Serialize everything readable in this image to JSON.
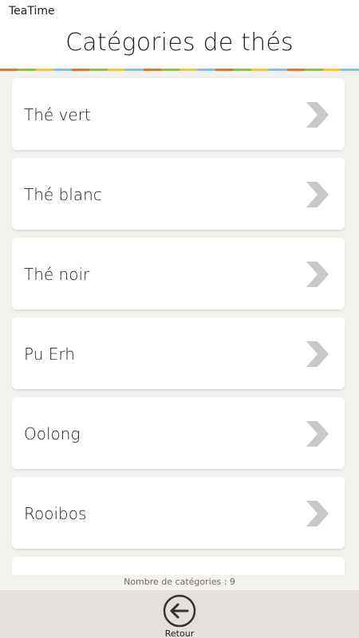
{
  "header": {
    "app_title": "TeaTime",
    "page_title": "Catégories de thés"
  },
  "categories": [
    {
      "label": "Thé vert"
    },
    {
      "label": "Thé blanc"
    },
    {
      "label": "Thé noir"
    },
    {
      "label": "Pu Erh"
    },
    {
      "label": "Oolong"
    },
    {
      "label": "Rooibos"
    }
  ],
  "footer": {
    "count_text": "Nombre de catégories : 9"
  },
  "bottom_bar": {
    "back_label": "Retour"
  },
  "colors": {
    "stripe": [
      "#e07a2e",
      "#8fc63e",
      "#f2c82e",
      "#7fc3e8"
    ],
    "chevron": "#c8c8c8",
    "bottom_bar": "#e4e0dc"
  }
}
